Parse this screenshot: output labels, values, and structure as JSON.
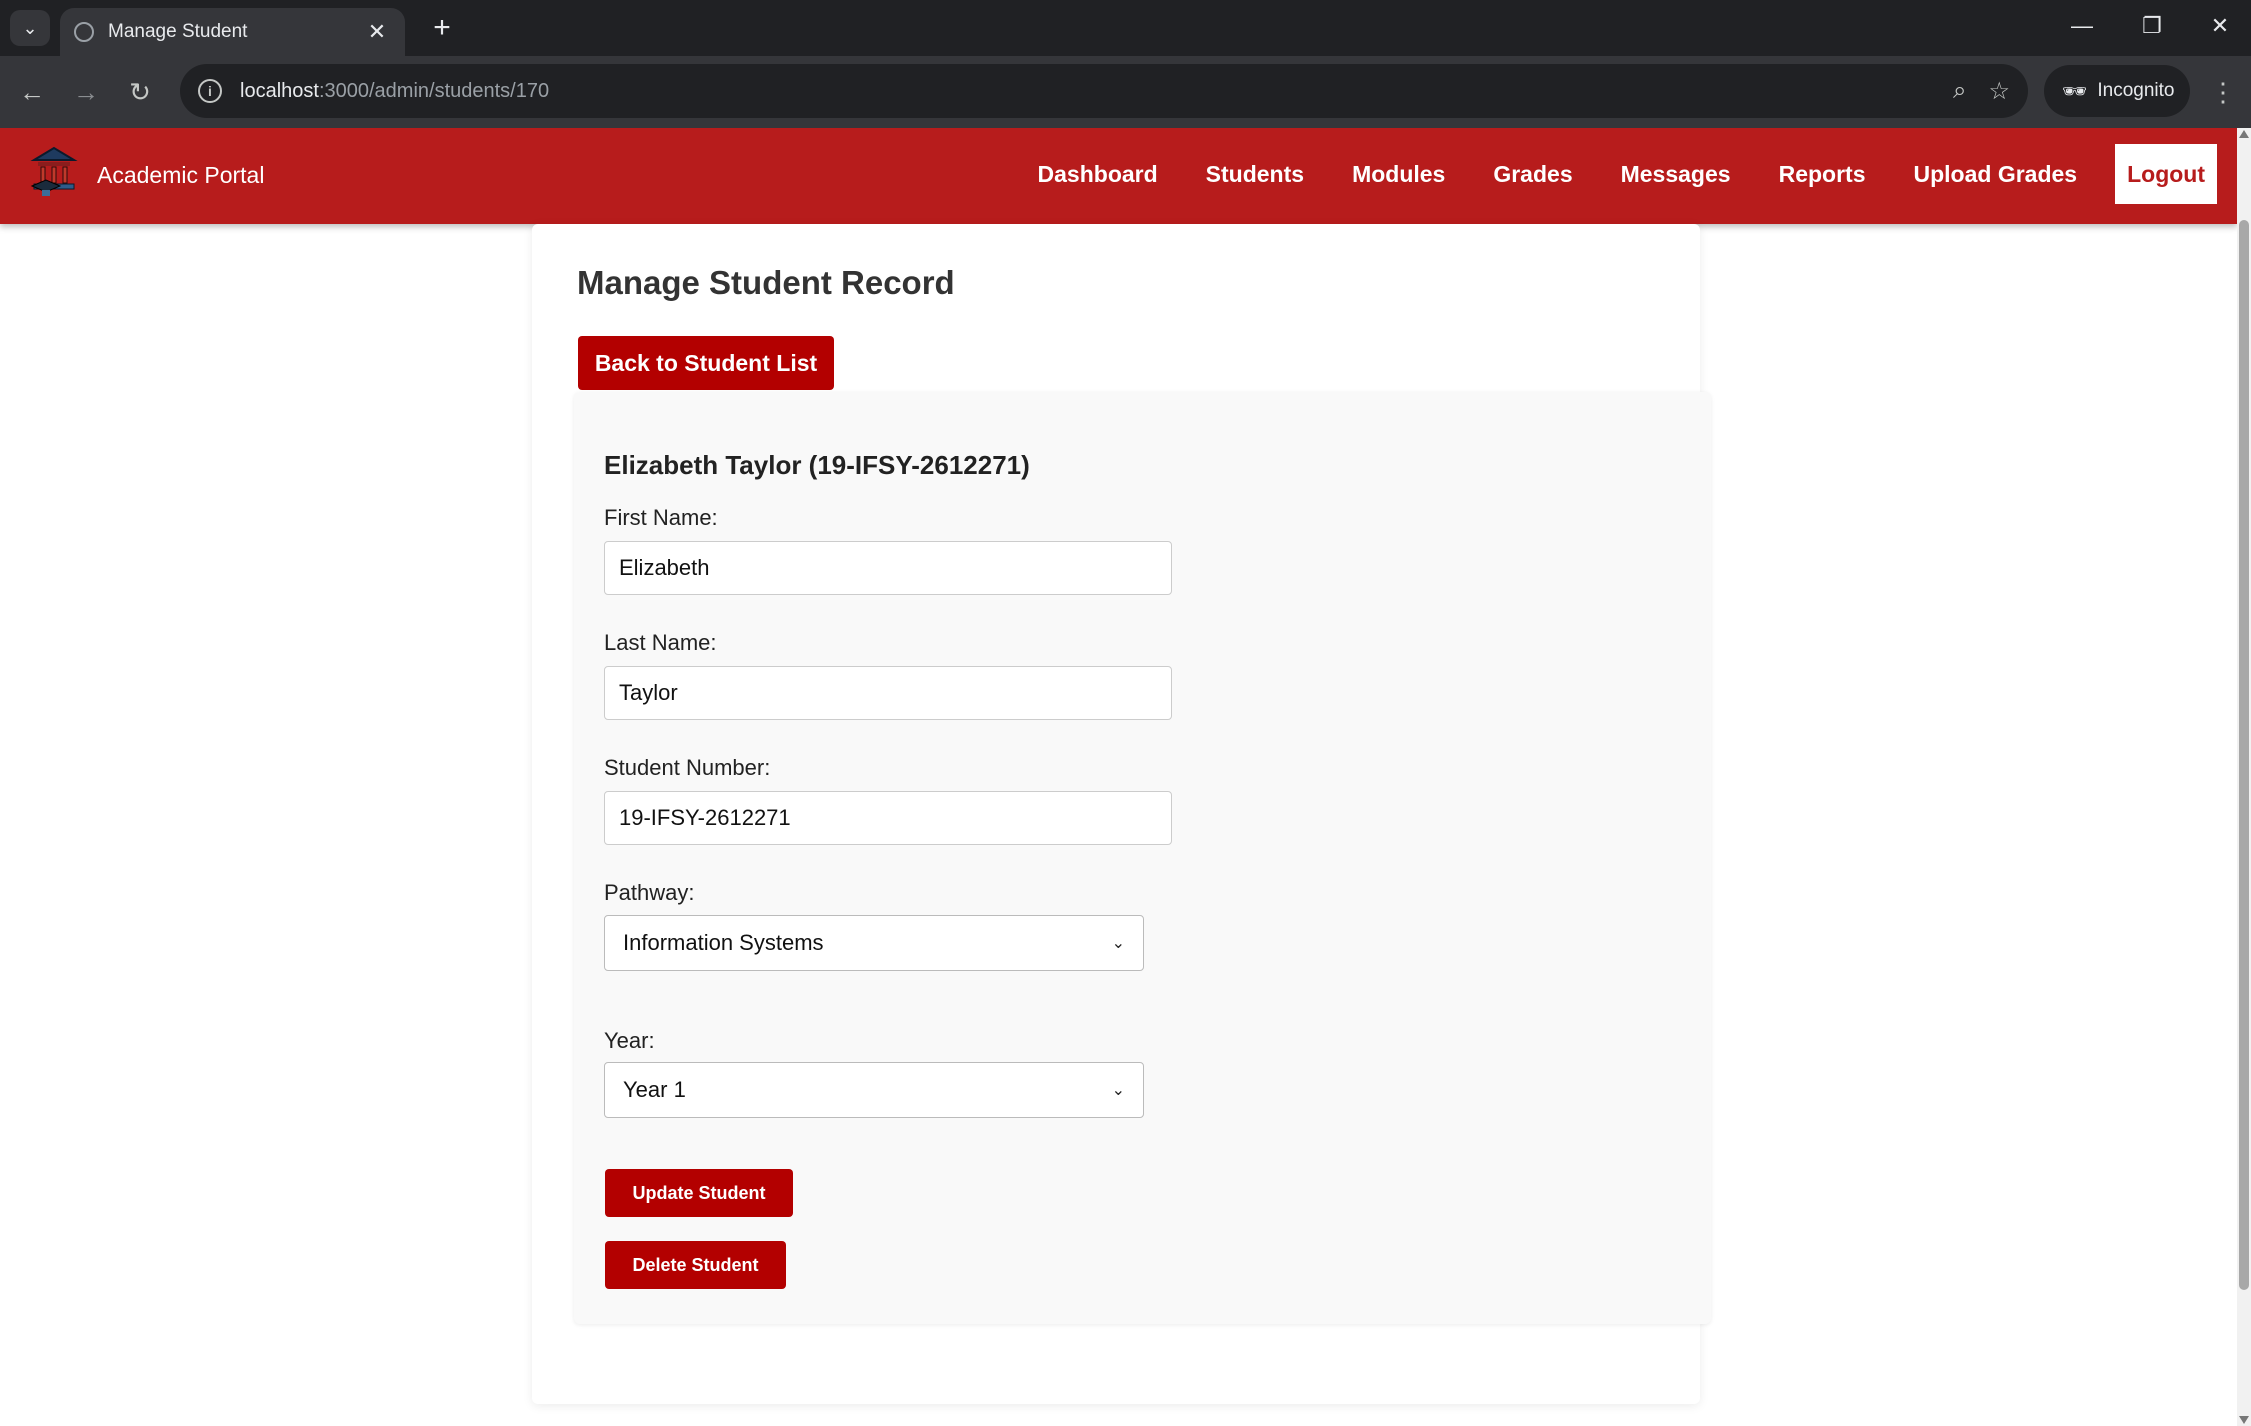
{
  "browser": {
    "tab_title": "Manage Student",
    "url_host": "localhost",
    "url_path": ":3000/admin/students/170",
    "incognito_label": "Incognito"
  },
  "app": {
    "brand": "Academic Portal",
    "nav": {
      "dashboard": "Dashboard",
      "students": "Students",
      "modules": "Modules",
      "grades": "Grades",
      "messages": "Messages",
      "reports": "Reports",
      "upload_grades": "Upload Grades",
      "logout": "Logout"
    },
    "accent_color": "#b71c1c"
  },
  "page": {
    "title": "Manage Student Record",
    "back_button": "Back to Student List",
    "student_heading": "Elizabeth Taylor (19-IFSY-2612271)",
    "form": {
      "first_name_label": "First Name:",
      "first_name_value": "Elizabeth",
      "last_name_label": "Last Name:",
      "last_name_value": "Taylor",
      "student_number_label": "Student Number:",
      "student_number_value": "19-IFSY-2612271",
      "pathway_label": "Pathway:",
      "pathway_selected": "Information Systems",
      "year_label": "Year:",
      "year_selected": "Year 1"
    },
    "update_button": "Update Student",
    "delete_button": "Delete Student"
  }
}
